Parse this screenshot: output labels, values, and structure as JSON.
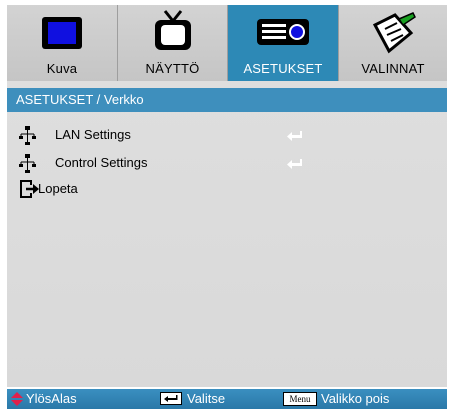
{
  "tabs": [
    {
      "label": "Kuva",
      "icon": "monitor-icon"
    },
    {
      "label": "NÄYTTÖ",
      "icon": "tv-icon"
    },
    {
      "label": "ASETUKSET",
      "icon": "projector-icon",
      "active": true
    },
    {
      "label": "VALINNAT",
      "icon": "notepad-pen-icon"
    }
  ],
  "breadcrumb": "ASETUKSET / Verkko",
  "menu": {
    "items": [
      {
        "label": "LAN Settings",
        "icon": "network-icon",
        "action_icon": "enter-icon"
      },
      {
        "label": "Control Settings",
        "icon": "network-icon",
        "action_icon": "enter-icon"
      },
      {
        "label": "Lopeta",
        "icon": "exit-icon"
      }
    ]
  },
  "helpbar": {
    "navigate_label": "YlösAlas",
    "select_label": "Valitse",
    "menu_key_label": "Menu",
    "exit_label": "Valikko pois"
  },
  "colors": {
    "accent": "#2d89b6",
    "tab_strip": "#cccccc",
    "panel": "#dcdcdc",
    "nav_arrow": "#e0204b"
  }
}
